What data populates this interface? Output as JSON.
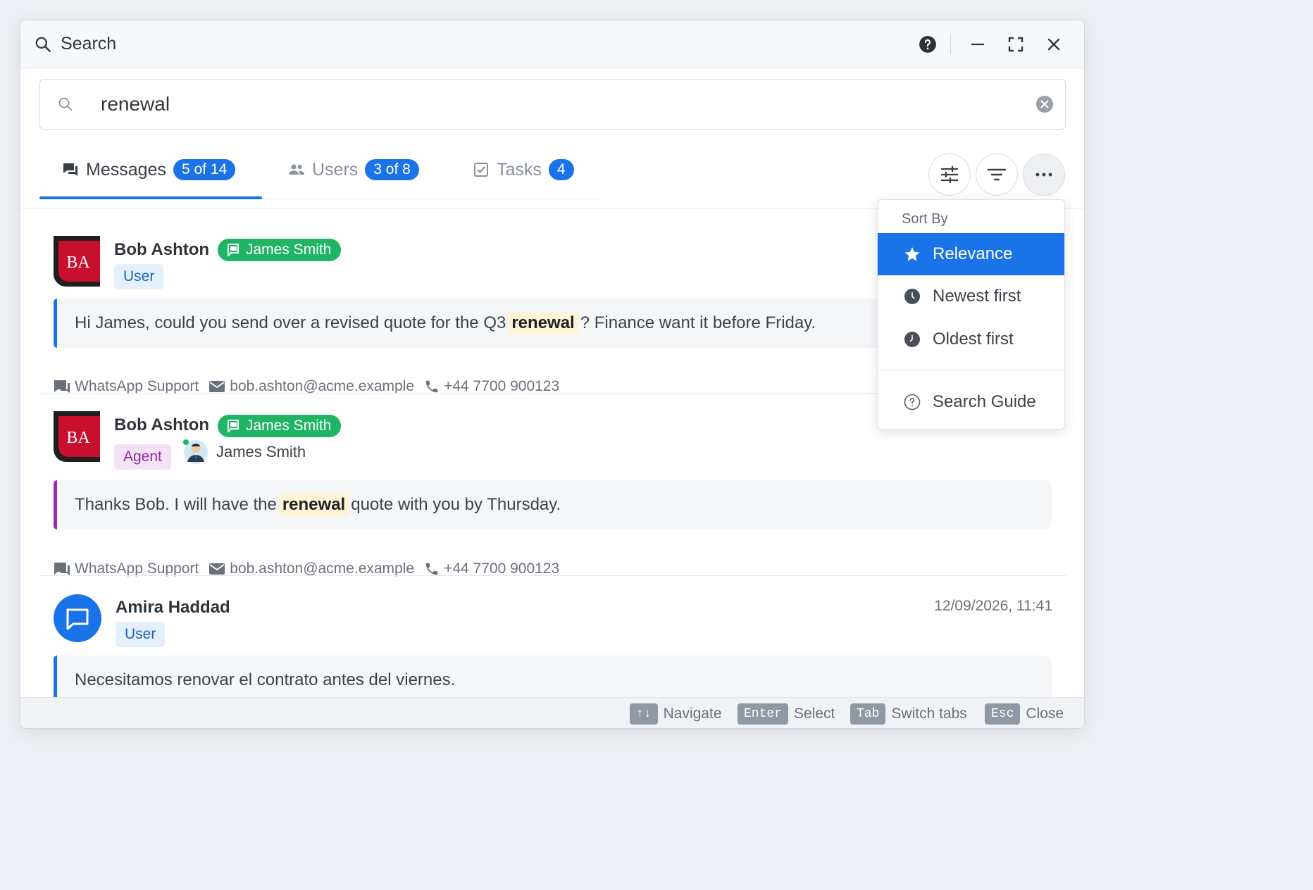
{
  "window": {
    "title": "Search"
  },
  "search": {
    "value": "renewal"
  },
  "tabs": [
    {
      "label": "Messages",
      "badge": "5 of 14",
      "active": true
    },
    {
      "label": "Users",
      "badge": "3 of 8"
    },
    {
      "label": "Tasks",
      "badge": "4"
    }
  ],
  "sort_menu": {
    "header": "Sort By",
    "items": [
      {
        "label": "Relevance",
        "selected": true
      },
      {
        "label": "Newest first"
      },
      {
        "label": "Oldest first"
      }
    ],
    "guide_label": "Search Guide"
  },
  "results": [
    {
      "avatar_initials": "BA",
      "name": "Bob Ashton",
      "channel_chip": "James Smith",
      "role": "User",
      "message_before": "Hi James, could you send over a revised quote for the Q3",
      "message_highlight": "renewal",
      "message_after": "? Finance want it before Friday.",
      "meta": {
        "channel": "WhatsApp Support",
        "email": "bob.ashton@acme.example",
        "phone": "+44 7700 900123"
      }
    },
    {
      "avatar_initials": "BA",
      "name": "Bob Ashton",
      "channel_chip": "James Smith",
      "role": "Agent",
      "agent_name": "James Smith",
      "message_before": "Thanks Bob. I will have the",
      "message_highlight": "renewal",
      "message_after": "quote with you by Thursday.",
      "meta": {
        "channel": "WhatsApp Support",
        "email": "bob.ashton@acme.example",
        "phone": "+44 7700 900123"
      }
    },
    {
      "name": "Amira Haddad",
      "role": "User",
      "date": "12/09/2026, 11:41",
      "message": "Necesitamos renovar el contrato antes del viernes."
    }
  ],
  "footer": {
    "hints": [
      {
        "key": "↑↓",
        "label": "Navigate"
      },
      {
        "key": "Enter",
        "label": "Select"
      },
      {
        "key": "Tab",
        "label": "Switch tabs"
      },
      {
        "key": "Esc",
        "label": "Close"
      }
    ]
  },
  "colors": {
    "accent": "#1a73e8",
    "chip_green": "#1fb466",
    "brand_red": "#c8102e",
    "user_bar": "#1a73e8",
    "agent_bar": "#9c27b0"
  }
}
